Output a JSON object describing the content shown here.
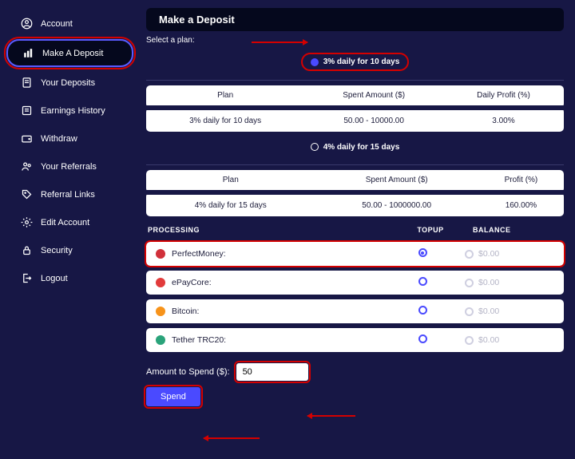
{
  "sidebar": {
    "items": [
      {
        "label": "Account",
        "icon": "user-circle-icon"
      },
      {
        "label": "Make A Deposit",
        "icon": "bar-chart-icon",
        "active": true
      },
      {
        "label": "Your Deposits",
        "icon": "document-icon"
      },
      {
        "label": "Earnings History",
        "icon": "list-icon"
      },
      {
        "label": "Withdraw",
        "icon": "wallet-icon"
      },
      {
        "label": "Your Referrals",
        "icon": "users-icon"
      },
      {
        "label": "Referral Links",
        "icon": "tag-icon"
      },
      {
        "label": "Edit Account",
        "icon": "gear-icon"
      },
      {
        "label": "Security",
        "icon": "lock-icon"
      },
      {
        "label": "Logout",
        "icon": "logout-icon"
      }
    ]
  },
  "page": {
    "title": "Make a Deposit",
    "select_plan_label": "Select a plan:"
  },
  "plans": [
    {
      "radio_label": "3% daily for 10 days",
      "selected": true,
      "columns": [
        "Plan",
        "Spent Amount ($)",
        "Daily Profit (%)"
      ],
      "row": [
        "3% daily for 10 days",
        "50.00 - 10000.00",
        "3.00%"
      ]
    },
    {
      "radio_label": "4% daily for 15 days",
      "selected": false,
      "columns": [
        "Plan",
        "Spent Amount ($)",
        "Profit (%)"
      ],
      "row": [
        "4% daily for 15 days",
        "50.00 - 1000000.00",
        "160.00%"
      ]
    }
  ],
  "processing": {
    "head": {
      "processing": "PROCESSING",
      "topup": "TOPUP",
      "balance": "BALANCE"
    },
    "rows": [
      {
        "name": "PerfectMoney:",
        "topup_selected": true,
        "balance": "$0.00",
        "color": "#d1303a"
      },
      {
        "name": "ePayCore:",
        "topup_selected": false,
        "balance": "$0.00",
        "color": "#e23b3b"
      },
      {
        "name": "Bitcoin:",
        "topup_selected": false,
        "balance": "$0.00",
        "color": "#f7931a"
      },
      {
        "name": "Tether TRC20:",
        "topup_selected": false,
        "balance": "$0.00",
        "color": "#2aa37a"
      }
    ]
  },
  "amount": {
    "label": "Amount to Spend ($):",
    "value": "50",
    "spend_button": "Spend"
  }
}
